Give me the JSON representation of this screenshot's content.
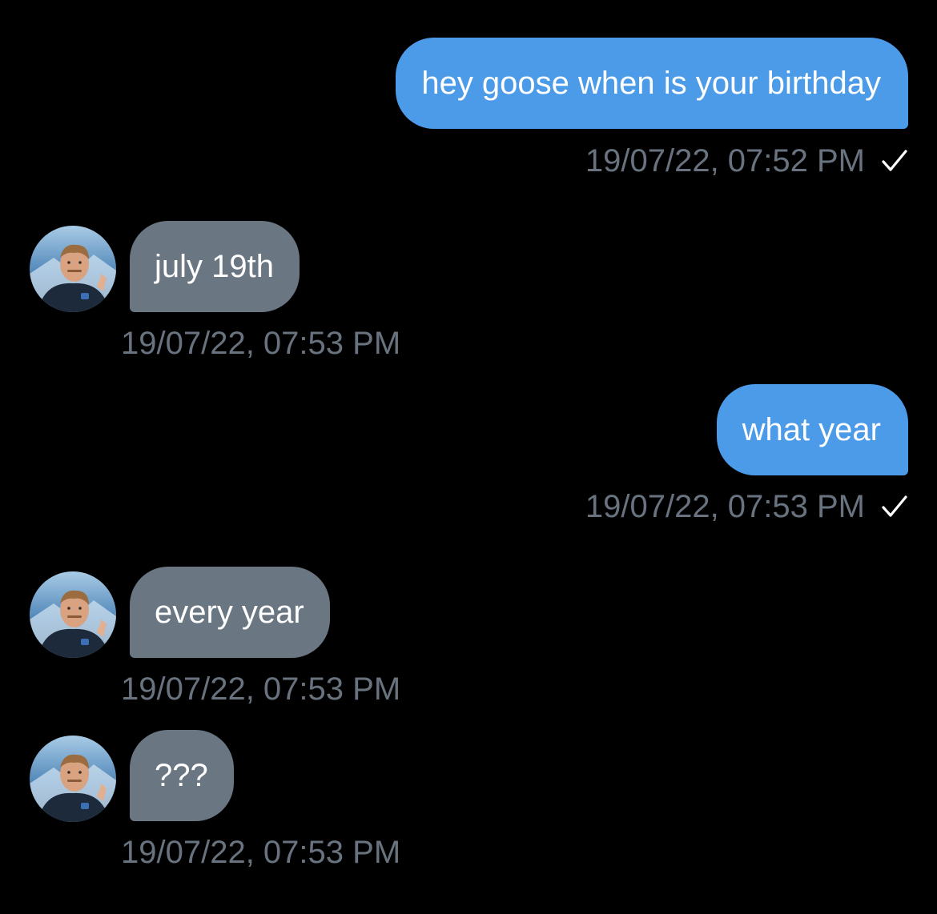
{
  "messages": [
    {
      "direction": "sent",
      "text": "hey goose when is your birthday",
      "timestamp": "19/07/22, 07:52 PM",
      "status_icon": "checkmark-icon"
    },
    {
      "direction": "received",
      "text": "july 19th",
      "timestamp": "19/07/22, 07:53 PM",
      "avatar": "avatar-photo"
    },
    {
      "direction": "sent",
      "text": "what year",
      "timestamp": "19/07/22, 07:53 PM",
      "status_icon": "checkmark-icon"
    },
    {
      "direction": "received",
      "text": "every year",
      "timestamp": "19/07/22, 07:53 PM",
      "avatar": "avatar-photo"
    },
    {
      "direction": "received",
      "text": "???",
      "timestamp": "19/07/22, 07:53 PM",
      "avatar": "avatar-photo"
    }
  ],
  "colors": {
    "background": "#000000",
    "sent_bubble": "#4c9be8",
    "received_bubble": "#6b7683",
    "timestamp_text": "#68737f",
    "message_text": "#ffffff"
  }
}
